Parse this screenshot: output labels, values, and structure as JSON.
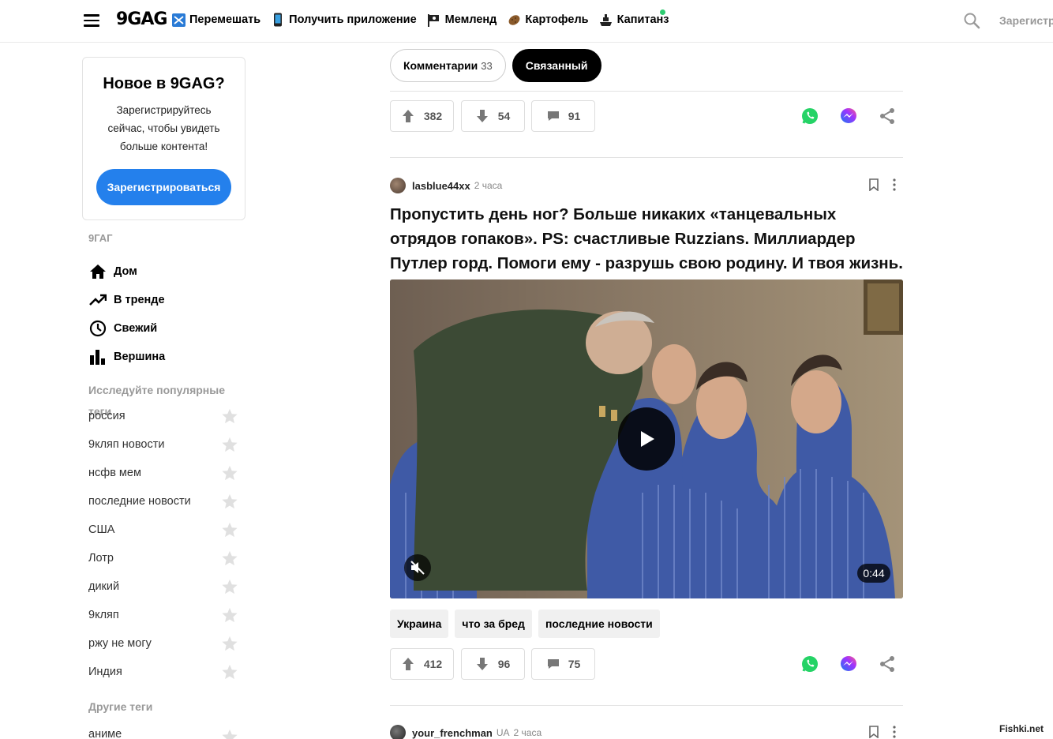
{
  "header": {
    "logo": "9GAG",
    "nav": [
      {
        "label": "Перемешать",
        "icon": "shuffle-icon"
      },
      {
        "label": "Получить приложение",
        "icon": "phone-icon"
      },
      {
        "label": "Мемленд",
        "icon": "flag-icon"
      },
      {
        "label": "Картофель",
        "icon": "potato-icon"
      },
      {
        "label": "Капитанз",
        "icon": "ship-icon"
      }
    ],
    "signup": "Зарегистр",
    "colors": {
      "online": "#2ecc71"
    }
  },
  "promo": {
    "title": "Новое в 9GAG?",
    "text": "Зарегистрируйтесь сейчас, чтобы увидеть больше контента!",
    "button": "Зарегистрироваться",
    "button_color": "#2480ec"
  },
  "sidebar": {
    "section": "9ГАГ",
    "nav": [
      {
        "label": "Дом",
        "icon": "home-icon"
      },
      {
        "label": "В тренде",
        "icon": "trending-icon"
      },
      {
        "label": "Свежий",
        "icon": "clock-icon"
      },
      {
        "label": "Вершина",
        "icon": "bar-chart-icon"
      }
    ],
    "explore_title": "Исследуйте популярные теги",
    "tags": [
      "россия",
      "9кляп новости",
      "нсфв мем",
      "последние новости",
      "США",
      "Лотр",
      "дикий",
      "9кляп",
      "ржу не могу",
      "Индия"
    ],
    "other_title": "Другие теги",
    "other_first": "аниме"
  },
  "tabs": {
    "comments_label": "Комментарии",
    "comments_count": "33",
    "related_label": "Связанный"
  },
  "post_prev": {
    "up": "382",
    "down": "54",
    "comments": "91"
  },
  "post": {
    "user": "lasblue44xx",
    "time": "2 часа",
    "title": "Пропустить день ног? Больше никаких «танцевальных отрядов гопаков». PS: счастливые Ruzzians. Миллиардер Путлер горд. Помоги ему - разрушь свою родину. И твоя жизнь.",
    "duration": "0:44",
    "tags": [
      "Украина",
      "что за бред",
      "последние новости"
    ],
    "up": "412",
    "down": "96",
    "comments": "75"
  },
  "post_next": {
    "user": "your_frenchman",
    "country": "UA",
    "time": "2 часа"
  },
  "watermark": "Fishki.net"
}
